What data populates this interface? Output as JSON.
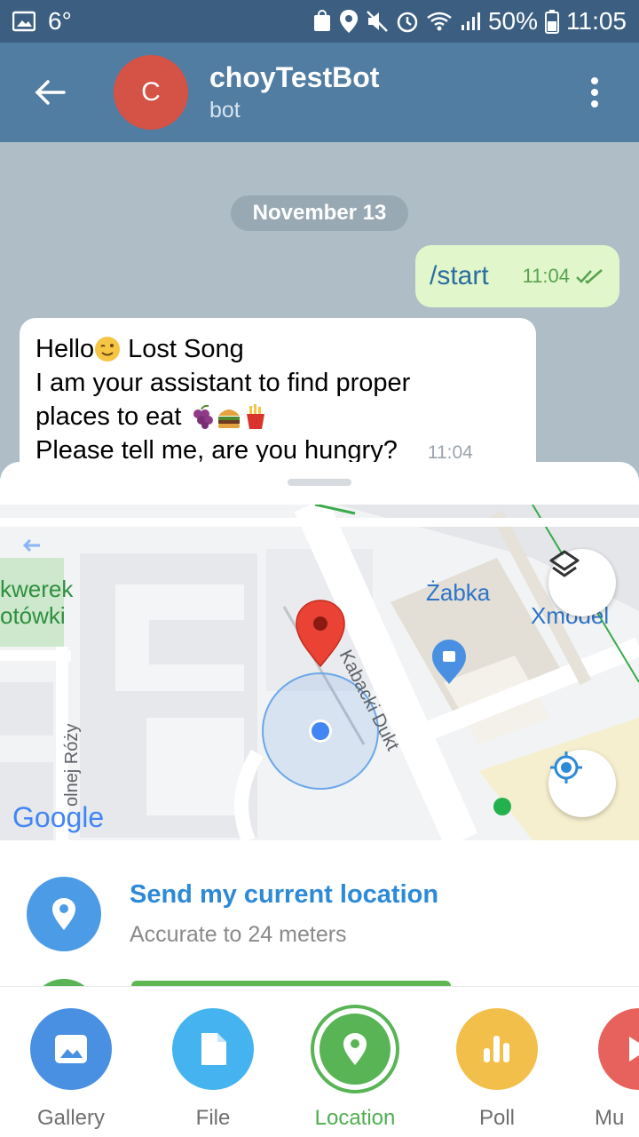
{
  "status_bar": {
    "temperature": "6°",
    "battery": "50%",
    "time": "11:05"
  },
  "header": {
    "avatar_letter": "C",
    "title": "choyTestBot",
    "subtitle": "bot"
  },
  "chat": {
    "date_chip": "November 13",
    "outgoing": {
      "text": "/start",
      "time": "11:04"
    },
    "incoming": {
      "line1_a": "Hello",
      "line1_b": " Lost Song",
      "line2": "I am your assistant to find proper",
      "line3": "places to eat ",
      "line4": "Please tell me, are you hungry?",
      "time": "11:04"
    }
  },
  "map": {
    "labels": {
      "park": "kwerek\notówki",
      "shop": "Żabka",
      "shop2": "Xmodel",
      "street1": "Kabacki Dukt",
      "street2": "olnej Róży",
      "google": "Google"
    },
    "layers_icon": "layers-icon",
    "my_location_icon": "my-location-icon"
  },
  "location": {
    "title": "Send my current location",
    "subtitle": "Accurate to 24 meters"
  },
  "tabs": [
    {
      "label": "Gallery",
      "color": "#4a90e2"
    },
    {
      "label": "File",
      "color": "#45b3f0"
    },
    {
      "label": "Location",
      "color": "#58b455"
    },
    {
      "label": "Poll",
      "color": "#f2c04a"
    },
    {
      "label": "Mu",
      "color": "#e8625d"
    }
  ]
}
